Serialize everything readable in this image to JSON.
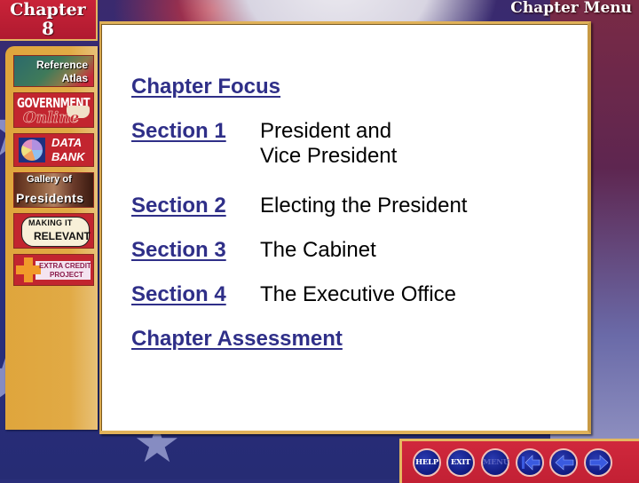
{
  "header": {
    "chapter_label": "Chapter",
    "chapter_number": "8",
    "menu_title": "Chapter Menu"
  },
  "sidebar": {
    "items": [
      {
        "id": "reference-atlas",
        "line1": "Reference",
        "line2": "Atlas"
      },
      {
        "id": "government-online",
        "line1": "GOVERNMENT",
        "line2": "Online"
      },
      {
        "id": "data-bank",
        "line1": "DATA",
        "line2": "BANK"
      },
      {
        "id": "gallery-of-presidents",
        "line1": "Gallery of",
        "line2": "Presidents"
      },
      {
        "id": "making-it-relevant",
        "line1": "MAKING IT",
        "line2": "RELEVANT"
      },
      {
        "id": "extra-credit-project",
        "line1": "EXTRA CREDIT",
        "line2": "PROJECT"
      }
    ]
  },
  "toc": {
    "chapter_focus": "Chapter Focus",
    "sections": [
      {
        "label": "Section 1",
        "title_line1": "President and",
        "title_line2": "Vice President"
      },
      {
        "label": "Section 2",
        "title_line1": "Electing the President"
      },
      {
        "label": "Section 3",
        "title_line1": "The Cabinet"
      },
      {
        "label": "Section 4",
        "title_line1": "The Executive Office"
      }
    ],
    "chapter_assessment": "Chapter Assessment"
  },
  "nav": {
    "help": "HELP",
    "exit": "EXIT",
    "menu": "MENU",
    "first_icon": "first-page-arrow",
    "back_icon": "back-arrow",
    "forward_icon": "forward-arrow"
  },
  "colors": {
    "link": "#2f2f88",
    "accent_red": "#c22034",
    "gold": "#e0b25a",
    "nav_blue": "#101a80"
  }
}
